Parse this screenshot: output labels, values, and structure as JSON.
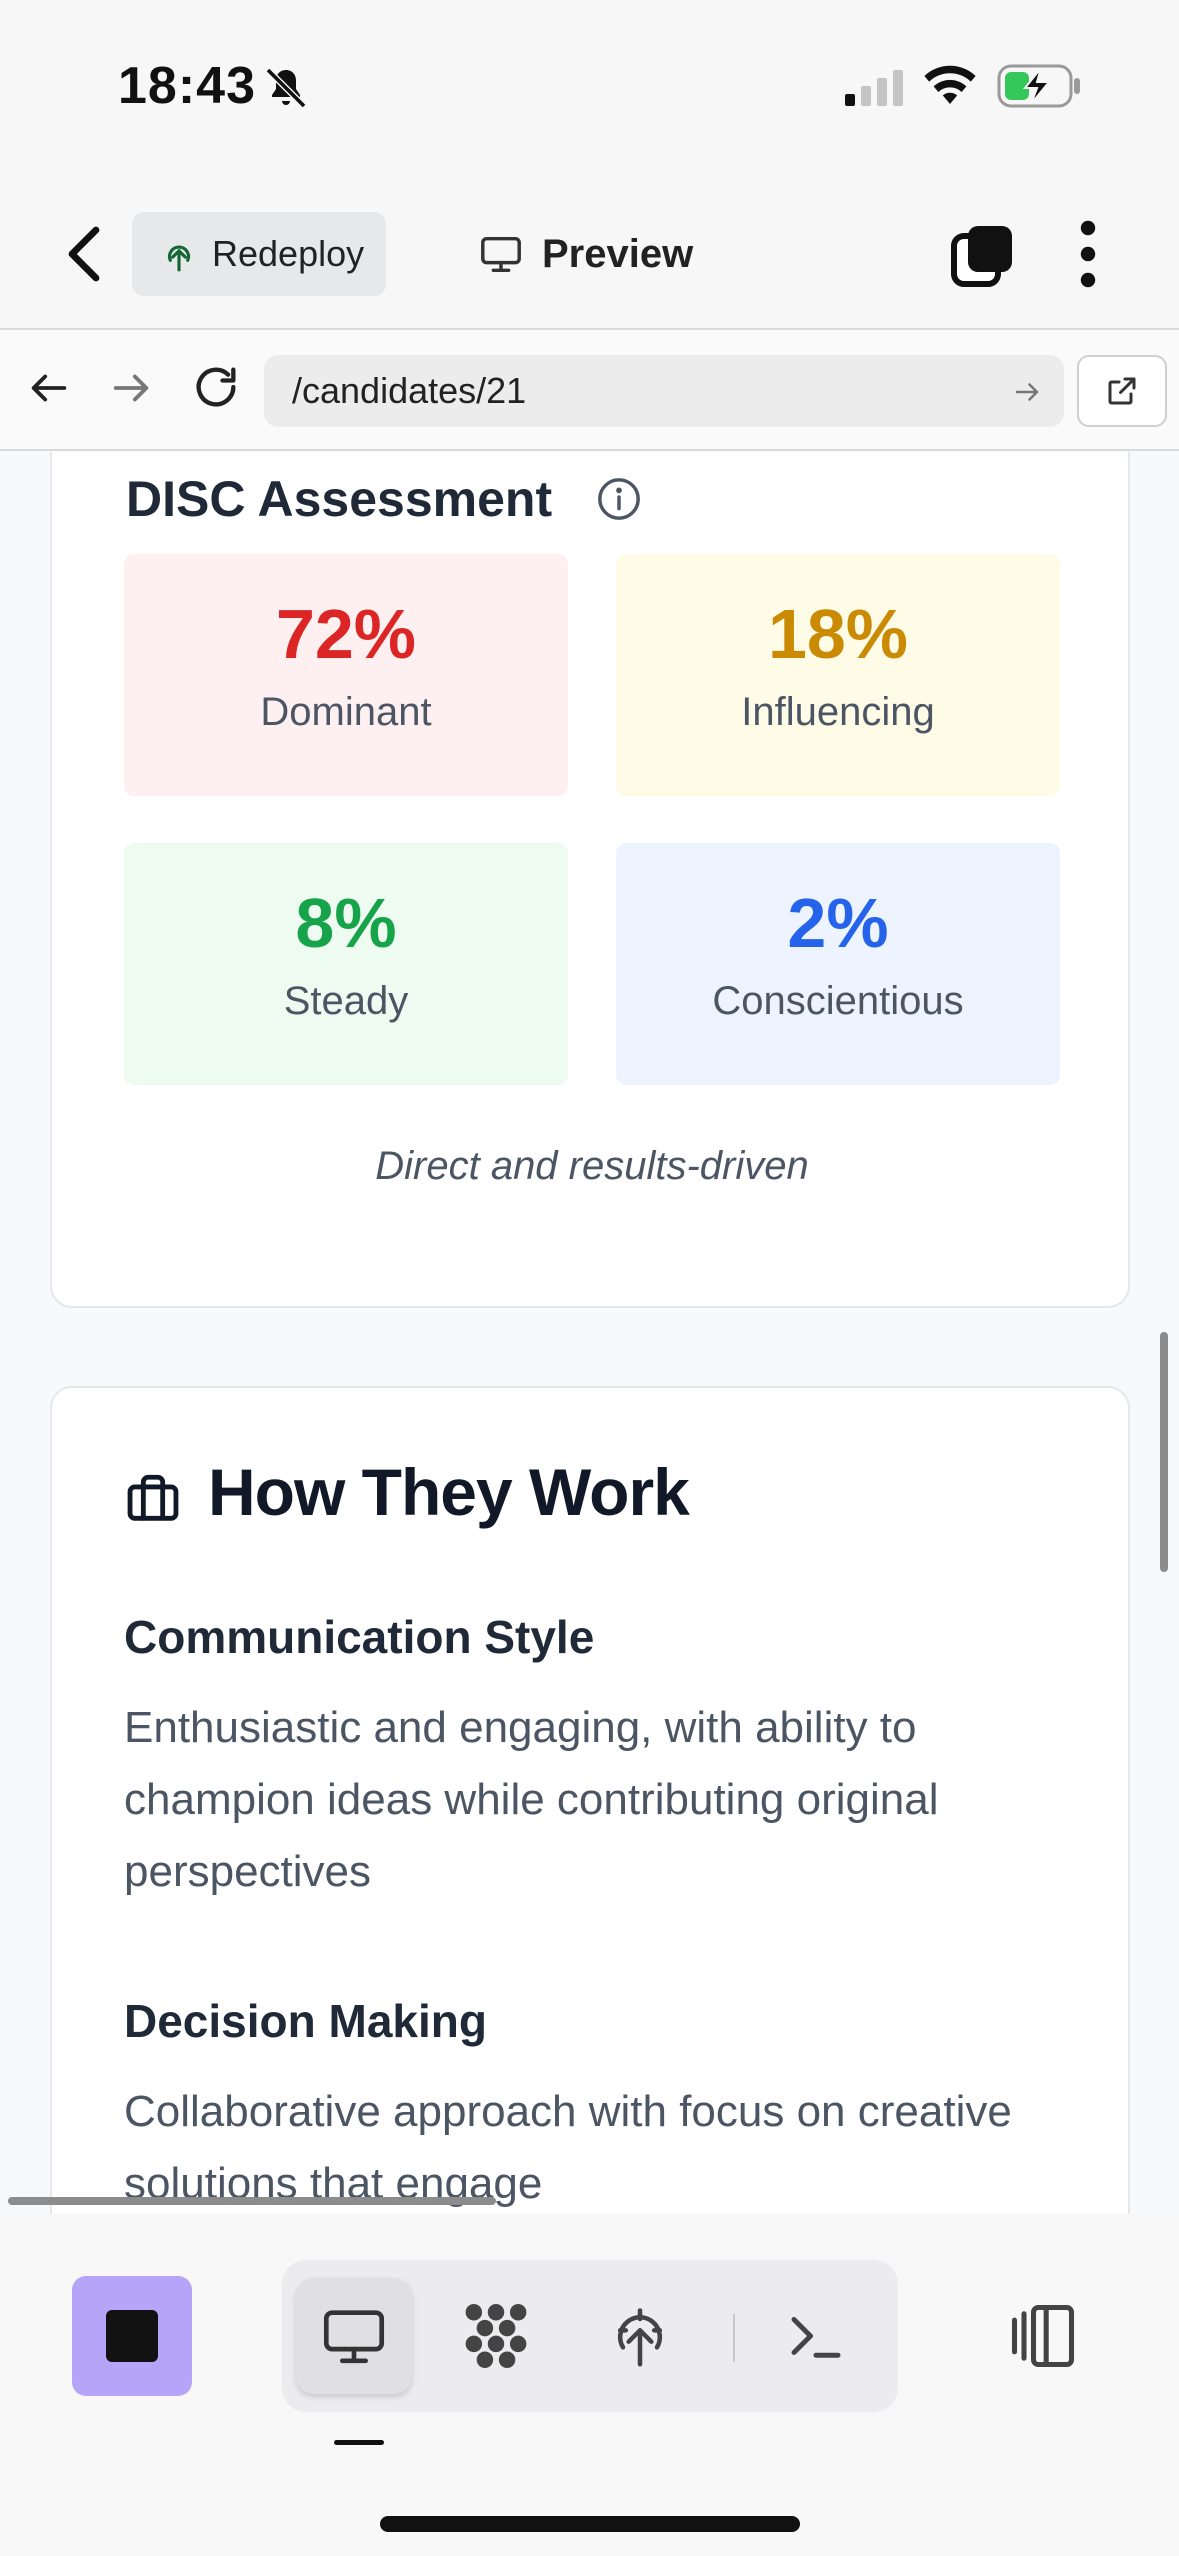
{
  "status_bar": {
    "time": "18:43",
    "icons": [
      "bell-slash-icon",
      "signal-icon",
      "wifi-icon",
      "battery-charging-icon"
    ]
  },
  "app_header": {
    "back_icon": "chevron-left-icon",
    "redeploy_label": "Redeploy",
    "redeploy_icon": "tree-upload-icon",
    "preview_label": "Preview",
    "preview_icon": "monitor-icon",
    "tabs_icon": "tabs-icon",
    "more_icon": "more-vertical-icon"
  },
  "url_bar": {
    "url": "/candidates/21",
    "icons": [
      "arrow-left-icon",
      "arrow-right-icon",
      "reload-icon",
      "go-arrow-icon",
      "external-link-icon"
    ]
  },
  "disc": {
    "title": "DISC Assessment",
    "info_icon": "info-icon",
    "tiles": [
      {
        "percent": "72%",
        "label": "Dominant",
        "color": "#dc2626"
      },
      {
        "percent": "18%",
        "label": "Influencing",
        "color": "#ca8a04"
      },
      {
        "percent": "8%",
        "label": "Steady",
        "color": "#16a34a"
      },
      {
        "percent": "2%",
        "label": "Conscientious",
        "color": "#2563eb"
      }
    ],
    "summary": "Direct and results-driven"
  },
  "how_they_work": {
    "title": "How They Work",
    "icon": "briefcase-icon",
    "sections": [
      {
        "heading": "Communication Style",
        "text": "Enthusiastic and engaging, with ability to champion ideas while contributing original perspectives"
      },
      {
        "heading": "Decision Making",
        "text": "Collaborative approach with focus on creative solutions that engage"
      }
    ]
  },
  "bottom_toolbar": {
    "stop_color": "#b4a5f9",
    "items": [
      "stop-icon",
      "monitor-icon",
      "dots-cluster-icon",
      "deploy-tree-icon",
      "terminal-icon",
      "split-panel-icon"
    ],
    "active_item": "monitor-icon"
  }
}
